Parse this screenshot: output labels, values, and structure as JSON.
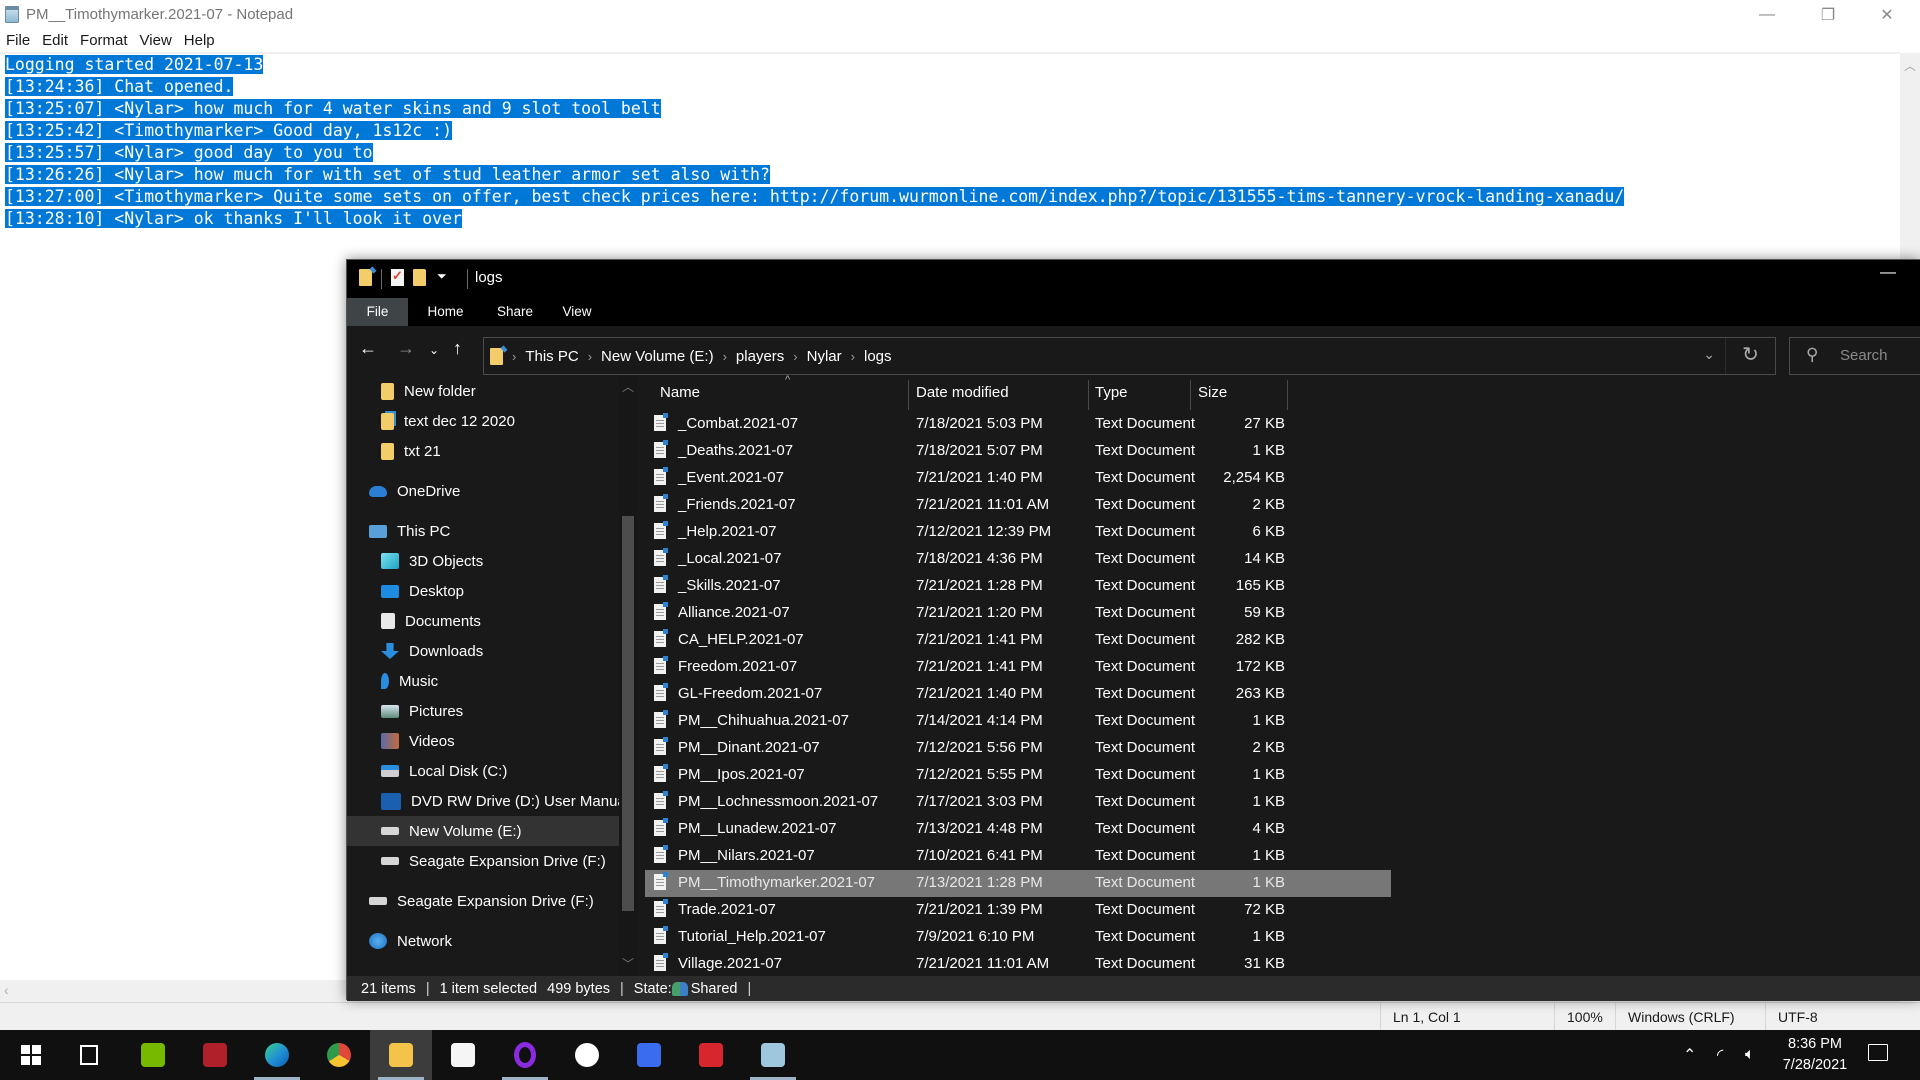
{
  "notepad": {
    "title": "PM__Timothymarker.2021-07 - Notepad",
    "menu": [
      "File",
      "Edit",
      "Format",
      "View",
      "Help"
    ],
    "lines": [
      "Logging started 2021-07-13",
      "[13:24:36] Chat opened.",
      "[13:25:07] <Nylar> how much for 4 water skins and 9 slot tool belt",
      "[13:25:42] <Timothymarker> Good day, 1s12c :)",
      "[13:25:57] <Nylar> good day to you to",
      "[13:26:26] <Nylar> how much for with set of stud leather armor set also with?",
      "[13:27:00] <Timothymarker> Quite some sets on offer, best check prices here: http://forum.wurmonline.com/index.php?/topic/131555-tims-tannery-vrock-landing-xanadu/",
      "[13:28:10] <Nylar> ok thanks I'll look it over"
    ],
    "status": {
      "position": "Ln 1, Col 1",
      "zoom": "100%",
      "line_ending": "Windows (CRLF)",
      "encoding": "UTF-8"
    },
    "controls": {
      "minimize": "—",
      "maximize": "❐",
      "close": "✕"
    }
  },
  "explorer": {
    "title": "logs",
    "ribbon_tabs": [
      "File",
      "Home",
      "Share",
      "View"
    ],
    "breadcrumb": [
      "This PC",
      "New Volume (E:)",
      "players",
      "Nylar",
      "logs"
    ],
    "search_placeholder": "Search",
    "nav_pane": [
      {
        "label": "New folder",
        "icon": "folder-icon",
        "indent": 2
      },
      {
        "label": "text dec 12 2020",
        "icon": "pinned-folder-icon",
        "indent": 2
      },
      {
        "label": "txt 21",
        "icon": "folder-icon",
        "indent": 2
      },
      {
        "label": "OneDrive",
        "icon": "onedrive-icon",
        "indent": 1
      },
      {
        "label": "This PC",
        "icon": "this-pc-icon",
        "indent": 1
      },
      {
        "label": "3D Objects",
        "icon": "3d-objects-icon",
        "indent": 2
      },
      {
        "label": "Desktop",
        "icon": "desktop-icon",
        "indent": 2
      },
      {
        "label": "Documents",
        "icon": "documents-icon",
        "indent": 2
      },
      {
        "label": "Downloads",
        "icon": "downloads-icon",
        "indent": 2
      },
      {
        "label": "Music",
        "icon": "music-icon",
        "indent": 2
      },
      {
        "label": "Pictures",
        "icon": "pictures-icon",
        "indent": 2
      },
      {
        "label": "Videos",
        "icon": "videos-icon",
        "indent": 2
      },
      {
        "label": "Local Disk (C:)",
        "icon": "local-disk-icon",
        "indent": 2
      },
      {
        "label": "DVD RW Drive (D:) User Manua",
        "icon": "dvd-drive-icon",
        "indent": 2
      },
      {
        "label": "New Volume (E:)",
        "icon": "drive-icon",
        "indent": 2,
        "selected": true
      },
      {
        "label": "Seagate Expansion Drive (F:)",
        "icon": "drive-icon",
        "indent": 2
      },
      {
        "label": "Seagate Expansion Drive (F:)",
        "icon": "drive-icon",
        "indent": 1
      },
      {
        "label": "Network",
        "icon": "network-icon",
        "indent": 1
      }
    ],
    "columns": [
      "Name",
      "Date modified",
      "Type",
      "Size"
    ],
    "files": [
      {
        "name": "_Combat.2021-07",
        "date": "7/18/2021 5:03 PM",
        "type": "Text Document",
        "size": "27 KB"
      },
      {
        "name": "_Deaths.2021-07",
        "date": "7/18/2021 5:07 PM",
        "type": "Text Document",
        "size": "1 KB"
      },
      {
        "name": "_Event.2021-07",
        "date": "7/21/2021 1:40 PM",
        "type": "Text Document",
        "size": "2,254 KB"
      },
      {
        "name": "_Friends.2021-07",
        "date": "7/21/2021 11:01 AM",
        "type": "Text Document",
        "size": "2 KB"
      },
      {
        "name": "_Help.2021-07",
        "date": "7/12/2021 12:39 PM",
        "type": "Text Document",
        "size": "6 KB"
      },
      {
        "name": "_Local.2021-07",
        "date": "7/18/2021 4:36 PM",
        "type": "Text Document",
        "size": "14 KB"
      },
      {
        "name": "_Skills.2021-07",
        "date": "7/21/2021 1:28 PM",
        "type": "Text Document",
        "size": "165 KB"
      },
      {
        "name": "Alliance.2021-07",
        "date": "7/21/2021 1:20 PM",
        "type": "Text Document",
        "size": "59 KB"
      },
      {
        "name": "CA_HELP.2021-07",
        "date": "7/21/2021 1:41 PM",
        "type": "Text Document",
        "size": "282 KB"
      },
      {
        "name": "Freedom.2021-07",
        "date": "7/21/2021 1:41 PM",
        "type": "Text Document",
        "size": "172 KB"
      },
      {
        "name": "GL-Freedom.2021-07",
        "date": "7/21/2021 1:40 PM",
        "type": "Text Document",
        "size": "263 KB"
      },
      {
        "name": "PM__Chihuahua.2021-07",
        "date": "7/14/2021 4:14 PM",
        "type": "Text Document",
        "size": "1 KB"
      },
      {
        "name": "PM__Dinant.2021-07",
        "date": "7/12/2021 5:56 PM",
        "type": "Text Document",
        "size": "2 KB"
      },
      {
        "name": "PM__Ipos.2021-07",
        "date": "7/12/2021 5:55 PM",
        "type": "Text Document",
        "size": "1 KB"
      },
      {
        "name": "PM__Lochnessmoon.2021-07",
        "date": "7/17/2021 3:03 PM",
        "type": "Text Document",
        "size": "1 KB"
      },
      {
        "name": "PM__Lunadew.2021-07",
        "date": "7/13/2021 4:48 PM",
        "type": "Text Document",
        "size": "4 KB"
      },
      {
        "name": "PM__Nilars.2021-07",
        "date": "7/10/2021 6:41 PM",
        "type": "Text Document",
        "size": "1 KB"
      },
      {
        "name": "PM__Timothymarker.2021-07",
        "date": "7/13/2021 1:28 PM",
        "type": "Text Document",
        "size": "1 KB",
        "selected": true
      },
      {
        "name": "Trade.2021-07",
        "date": "7/21/2021 1:39 PM",
        "type": "Text Document",
        "size": "72 KB"
      },
      {
        "name": "Tutorial_Help.2021-07",
        "date": "7/9/2021 6:10 PM",
        "type": "Text Document",
        "size": "1 KB"
      },
      {
        "name": "Village.2021-07",
        "date": "7/21/2021 11:01 AM",
        "type": "Text Document",
        "size": "31 KB"
      }
    ],
    "status": {
      "items": "21 items",
      "selected": "1 item selected",
      "bytes": "499 bytes",
      "state_label": "State:",
      "state_value": "Shared"
    }
  },
  "taskbar": {
    "apps": [
      {
        "name": "start",
        "icon": "windows-start-icon"
      },
      {
        "name": "task-view",
        "icon": "task-view-icon"
      },
      {
        "name": "nvidia",
        "icon": "nvidia-icon",
        "color": "#76b900"
      },
      {
        "name": "app-red",
        "icon": "app-red-icon",
        "color": "#b0202a"
      },
      {
        "name": "edge",
        "icon": "edge-icon",
        "color": "#1f8fd6"
      },
      {
        "name": "chrome",
        "icon": "chrome-icon",
        "color": "#e0463a"
      },
      {
        "name": "file-explorer",
        "icon": "file-explorer-icon",
        "color": "#f3c34a",
        "active": true
      },
      {
        "name": "store",
        "icon": "store-icon",
        "color": "#f5f5f5"
      },
      {
        "name": "cortana",
        "icon": "cortana-ring-icon",
        "color": "#8a2be2"
      },
      {
        "name": "xbox",
        "icon": "xbox-icon",
        "color": "#ffffff"
      },
      {
        "name": "wondershare",
        "icon": "wondershare-icon",
        "color": "#3a6cf0"
      },
      {
        "name": "screen-recorder",
        "icon": "screen-recorder-icon",
        "color": "#d8262e"
      },
      {
        "name": "notepad",
        "icon": "notepad-icon",
        "color": "#9ec6dc"
      }
    ],
    "time": "8:36 PM",
    "date": "7/28/2021"
  },
  "colors": {
    "selection": "#0078d7",
    "explorer_bg": "#191919",
    "taskbar_bg": "#101010"
  }
}
